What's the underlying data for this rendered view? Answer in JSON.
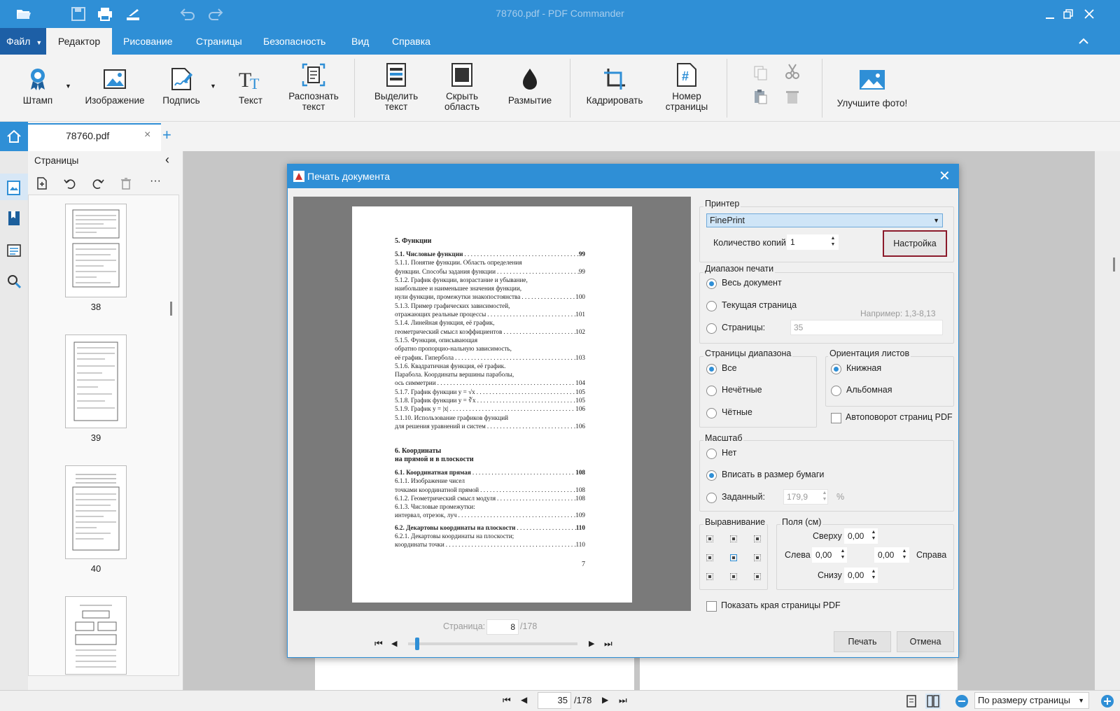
{
  "window": {
    "title": "78760.pdf - PDF Commander"
  },
  "menu": {
    "file": "Файл",
    "items": [
      "Редактор",
      "Рисование",
      "Страницы",
      "Безопасность",
      "Вид",
      "Справка"
    ]
  },
  "ribbon": {
    "stamp": "Штамп",
    "image": "Изображение",
    "signature": "Подпись",
    "text": "Текст",
    "ocr": [
      "Распознать",
      "текст"
    ],
    "highlight": [
      "Выделить",
      "текст"
    ],
    "hide_area": [
      "Скрыть",
      "область"
    ],
    "blur": "Размытие",
    "crop": "Кадрировать",
    "page_number": [
      "Номер",
      "страницы"
    ],
    "enhance": "Улучшите фото!"
  },
  "tab": {
    "filename": "78760.pdf"
  },
  "pages_panel": {
    "title": "Страницы",
    "thumbnails": [
      "38",
      "39",
      "40"
    ]
  },
  "dialog": {
    "title": "Печать документа",
    "printer": {
      "label": "Принтер",
      "selected": "FinePrint",
      "copies_label": "Количество копий",
      "copies": "1",
      "setup": "Настройка"
    },
    "range": {
      "label": "Диапазон печати",
      "all": "Весь документ",
      "current": "Текущая страница",
      "pages": "Страницы:",
      "pages_value": "35",
      "example": "Например: 1,3-8,13"
    },
    "range_pages": {
      "label": "Страницы диапазона",
      "all": "Все",
      "odd": "Нечётные",
      "even": "Чётные"
    },
    "orientation": {
      "label": "Ориентация листов",
      "portrait": "Книжная",
      "landscape": "Альбомная",
      "autorotate": "Автоповорот страниц PDF"
    },
    "scale": {
      "label": "Масштаб",
      "none": "Нет",
      "fit": "Вписать в размер бумаги",
      "custom": "Заданный:",
      "custom_value": "179,9",
      "unit": "%"
    },
    "align": {
      "label": "Выравнивание"
    },
    "margins": {
      "label": "Поля (см)",
      "top_label": "Сверху",
      "top": "0,00",
      "left_label": "Слева",
      "left": "0,00",
      "right_label": "Справа",
      "right": "0,00",
      "bottom_label": "Снизу",
      "bottom": "0,00"
    },
    "show_edges": "Показать края страницы PDF",
    "preview": {
      "page_label": "Страница:",
      "page": "8",
      "total": "/178"
    },
    "print": "Печать",
    "cancel": "Отмена"
  },
  "preview_page": {
    "chapter5": "5. Функции",
    "toc": [
      {
        "t": "5.1. Числовые функции",
        "p": "99",
        "b": true
      },
      {
        "t": "5.1.1. Понятие функции. Область определения",
        "p": "",
        "b": false
      },
      {
        "t": "функции. Способы задания функции",
        "p": "99",
        "b": false
      },
      {
        "t": "5.1.2. График функции, возрастание и убывание,",
        "p": "",
        "b": false
      },
      {
        "t": "наибольшее и наименьшее значения функции,",
        "p": "",
        "b": false
      },
      {
        "t": "нули функции, промежутки знакопостоянства",
        "p": "100",
        "b": false
      },
      {
        "t": "5.1.3. Пример графических зависимостей,",
        "p": "",
        "b": false
      },
      {
        "t": "отражающих реальные процессы",
        "p": "101",
        "b": false
      },
      {
        "t": "5.1.4. Линейная функция, её график,",
        "p": "",
        "b": false
      },
      {
        "t": "геометрический смысл коэффициентов",
        "p": "102",
        "b": false
      },
      {
        "t": "5.1.5. Функция, описывающая",
        "p": "",
        "b": false
      },
      {
        "t": "обратно пропорцио-нальную зависимость,",
        "p": "",
        "b": false
      },
      {
        "t": "её график. Гипербола",
        "p": "103",
        "b": false
      },
      {
        "t": "5.1.6. Квадратичная функция, её график.",
        "p": "",
        "b": false
      },
      {
        "t": "Парабола. Координаты вершины параболы,",
        "p": "",
        "b": false
      },
      {
        "t": "ось симметрии",
        "p": "104",
        "b": false
      },
      {
        "t": "5.1.7. График функции y = √x",
        "p": "105",
        "b": false
      },
      {
        "t": "5.1.8. График функции y = ∛x",
        "p": "105",
        "b": false
      },
      {
        "t": "5.1.9. График y = |x|",
        "p": "106",
        "b": false
      },
      {
        "t": "5.1.10. Использование графиков функций",
        "p": "",
        "b": false
      },
      {
        "t": "для решения уравнений и систем",
        "p": "106",
        "b": false
      }
    ],
    "chapter6": [
      "6. Координаты",
      "на прямой и в плоскости"
    ],
    "toc2": [
      {
        "t": "6.1. Координатная прямая",
        "p": "108",
        "b": true
      },
      {
        "t": "6.1.1. Изображение чисел",
        "p": "",
        "b": false
      },
      {
        "t": "точками координатной прямой",
        "p": "108",
        "b": false
      },
      {
        "t": "6.1.2. Геометрический смысл модуля",
        "p": "108",
        "b": false
      },
      {
        "t": "6.1.3. Числовые промежутки:",
        "p": "",
        "b": false
      },
      {
        "t": "интервал, отрезок, луч",
        "p": "109",
        "b": false
      },
      {
        "t": "6.2. Декартовы координаты на плоскости",
        "p": "110",
        "b": true
      },
      {
        "t": "6.2.1. Декартовы координаты на плоскости;",
        "p": "",
        "b": false
      },
      {
        "t": "координаты точки",
        "p": "110",
        "b": false
      }
    ],
    "page_no": "7"
  },
  "bottom": {
    "page": "35",
    "total": "/178",
    "zoom": "По размеру страницы"
  },
  "colors": {
    "accent": "#2f8fd6",
    "menu_active": "#1d5fa6",
    "highlight_border": "#8b1a2b"
  }
}
